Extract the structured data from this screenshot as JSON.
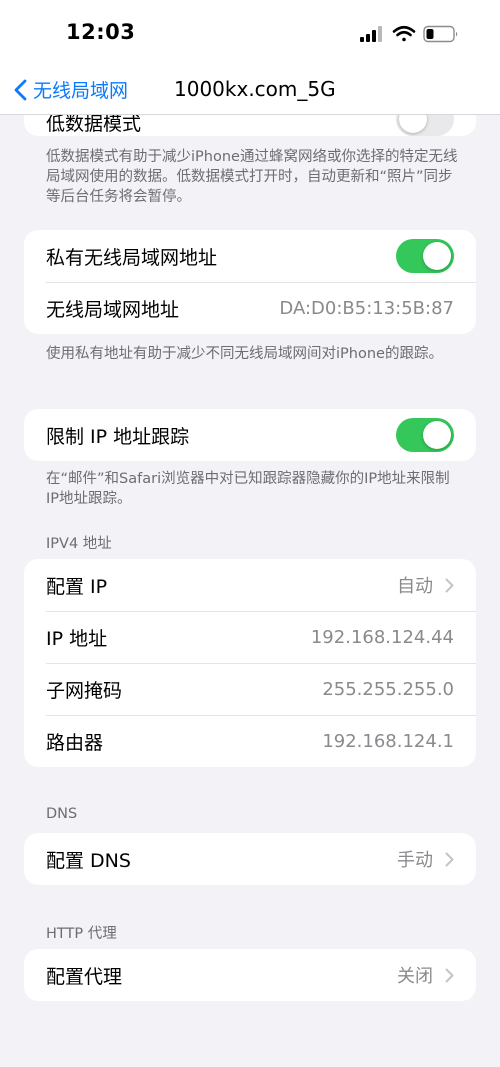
{
  "status_bar": {
    "time": "12:03"
  },
  "nav": {
    "back_label": "无线局域网",
    "title": "1000kx.com_5G"
  },
  "low_data": {
    "label": "低数据模式",
    "toggle_on": false,
    "note": "低数据模式有助于减少iPhone通过蜂窝网络或你选择的特定无线局域网使用的数据。低数据模式打开时，自动更新和“照片”同步等后台任务将会暂停。"
  },
  "private_address": {
    "toggle_label": "私有无线局域网地址",
    "toggle_on": true,
    "address_label": "无线局域网地址",
    "address_value": "DA:D0:B5:13:5B:87",
    "note": "使用私有地址有助于减少不同无线局域网间对iPhone的跟踪。"
  },
  "limit_tracking": {
    "label": "限制 IP 地址跟踪",
    "toggle_on": true,
    "note": "在“邮件”和Safari浏览器中对已知跟踪器隐藏你的IP地址来限制IP地址跟踪。"
  },
  "ipv4": {
    "header": "IPV4 地址",
    "rows": [
      {
        "label": "配置 IP",
        "value": "自动"
      },
      {
        "label": "IP 地址",
        "value": "192.168.124.44"
      },
      {
        "label": "子网掩码",
        "value": "255.255.255.0"
      },
      {
        "label": "路由器",
        "value": "192.168.124.1"
      }
    ]
  },
  "dns": {
    "header": "DNS",
    "label": "配置 DNS",
    "value": "手动"
  },
  "http_proxy": {
    "header": "HTTP 代理",
    "label": "配置代理",
    "value": "关闭"
  },
  "colors": {
    "accent": "#0a7aff",
    "toggle_on": "#34c759",
    "background": "#f2f2f7"
  }
}
